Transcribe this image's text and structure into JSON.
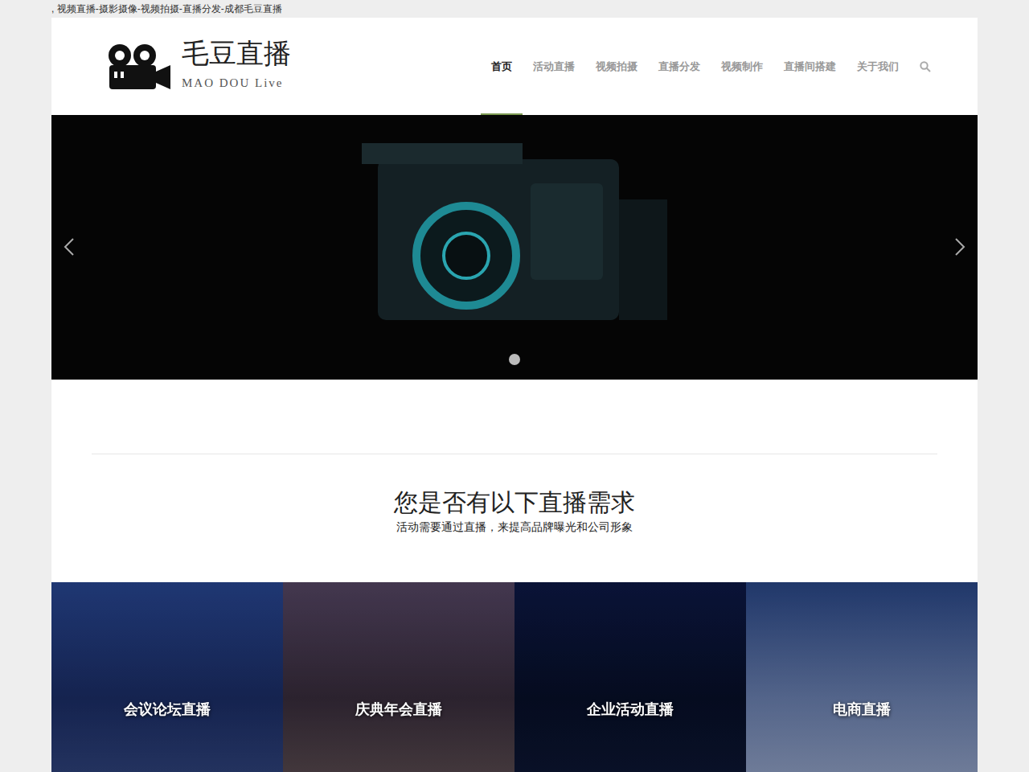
{
  "page_title": ", 视频直播-摄影摄像-视频拍摄-直播分发-成都毛豆直播",
  "logo": {
    "name": "毛豆直播",
    "tagline": "MAO DOU Live"
  },
  "nav": [
    {
      "label": "首页",
      "selected": true
    },
    {
      "label": "活动直播",
      "selected": false
    },
    {
      "label": "视频拍摄",
      "selected": false
    },
    {
      "label": "直播分发",
      "selected": false
    },
    {
      "label": "视频制作",
      "selected": false
    },
    {
      "label": "直播间搭建",
      "selected": false
    },
    {
      "label": "关于我们",
      "selected": false
    }
  ],
  "slider": {
    "dots": [
      {
        "selected": true
      }
    ]
  },
  "section": {
    "title": "您是否有以下直播需求",
    "subtitle": "活动需要通过直播，来提高品牌曝光和公司形象"
  },
  "tiles": [
    {
      "label": "会议论坛直播"
    },
    {
      "label": "庆典年会直播"
    },
    {
      "label": "企业活动直播"
    },
    {
      "label": "电商直播"
    }
  ]
}
